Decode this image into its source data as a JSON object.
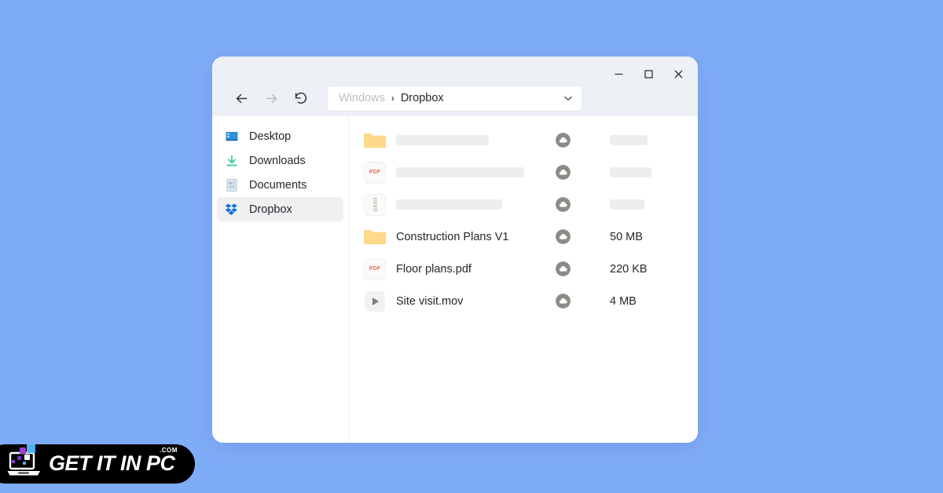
{
  "desktop": {
    "background_color": "#7FACF7"
  },
  "window": {
    "title_controls": {
      "minimize_label": "Minimize",
      "maximize_label": "Maximize",
      "close_label": "Close"
    },
    "navigation": {
      "back_label": "Back",
      "forward_label": "Forward",
      "refresh_label": "Refresh"
    },
    "address_bar": {
      "root_crumb": "Windows",
      "separator": "›",
      "current_crumb": "Dropbox"
    }
  },
  "sidebar": {
    "items": [
      {
        "label": "Desktop",
        "icon": "desktop-icon",
        "selected": false
      },
      {
        "label": "Downloads",
        "icon": "download-icon",
        "selected": false
      },
      {
        "label": "Documents",
        "icon": "document-icon",
        "selected": false
      },
      {
        "label": "Dropbox",
        "icon": "dropbox-icon",
        "selected": true
      }
    ]
  },
  "file_list": {
    "rows": [
      {
        "icon": "folder-icon",
        "name": "",
        "size": "",
        "placeholder": true,
        "name_bar_width": 118,
        "size_bar_width": 48,
        "sync": "cloud-icon"
      },
      {
        "icon": "pdf-icon",
        "name": "",
        "size": "",
        "placeholder": true,
        "name_bar_width": 163,
        "size_bar_width": 53,
        "sync": "cloud-icon"
      },
      {
        "icon": "archive-icon",
        "name": "",
        "size": "",
        "placeholder": true,
        "name_bar_width": 135,
        "size_bar_width": 44,
        "sync": "cloud-icon"
      },
      {
        "icon": "folder-icon",
        "name": "Construction Plans V1",
        "size": "50 MB",
        "placeholder": false,
        "sync": "cloud-icon"
      },
      {
        "icon": "pdf-icon",
        "name": "Floor plans.pdf",
        "size": "220 KB",
        "placeholder": false,
        "sync": "cloud-icon"
      },
      {
        "icon": "video-icon",
        "name": "Site visit.mov",
        "size": "4 MB",
        "placeholder": false,
        "sync": "cloud-icon"
      }
    ],
    "pdf_badge_text": "PDF"
  },
  "watermark": {
    "brand": "GET IT IN PC",
    "tld": ".COM"
  },
  "colors": {
    "desktop": "#7FACF7",
    "titlebar": "#EDF0F5",
    "folder": "#FCD98B",
    "dropbox_blue": "#0F6FE4",
    "download_green": "#2ECC8F",
    "desktop_blue": "#2F92DA",
    "cloud_gray": "#8C8C87",
    "skeleton": "#EDEDED",
    "pdf_red": "#F4704A"
  }
}
